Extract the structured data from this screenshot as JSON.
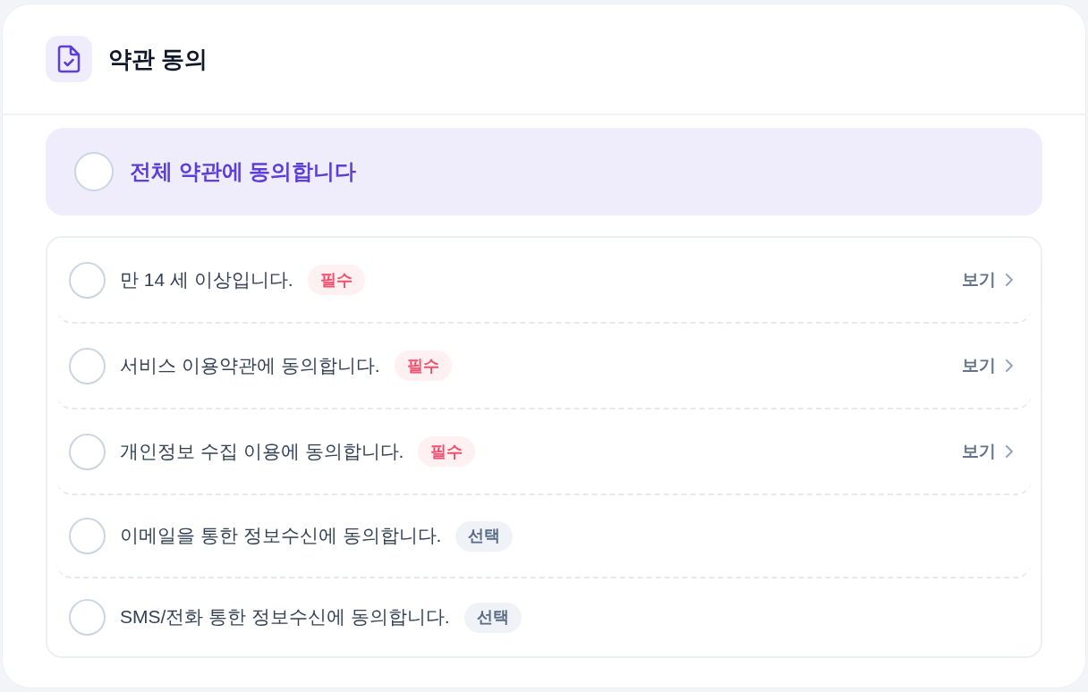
{
  "header": {
    "title": "약관 동의"
  },
  "all_agree": {
    "label": "전체 약관에 동의합니다",
    "checked": false
  },
  "terms": [
    {
      "label": "만 14 세 이상입니다.",
      "checked": false,
      "badge": {
        "text": "필수",
        "kind": "required"
      },
      "view_link": "보기"
    },
    {
      "label": "서비스 이용약관에 동의합니다.",
      "checked": false,
      "badge": {
        "text": "필수",
        "kind": "required"
      },
      "view_link": "보기"
    },
    {
      "label": "개인정보 수집 이용에 동의합니다.",
      "checked": false,
      "badge": {
        "text": "필수",
        "kind": "required"
      },
      "view_link": "보기"
    },
    {
      "label": "이메일을 통한 정보수신에 동의합니다.",
      "checked": false,
      "badge": {
        "text": "선택",
        "kind": "optional"
      }
    },
    {
      "label": "SMS/전화 통한 정보수신에 동의합니다.",
      "checked": false,
      "badge": {
        "text": "선택",
        "kind": "optional"
      }
    }
  ]
}
